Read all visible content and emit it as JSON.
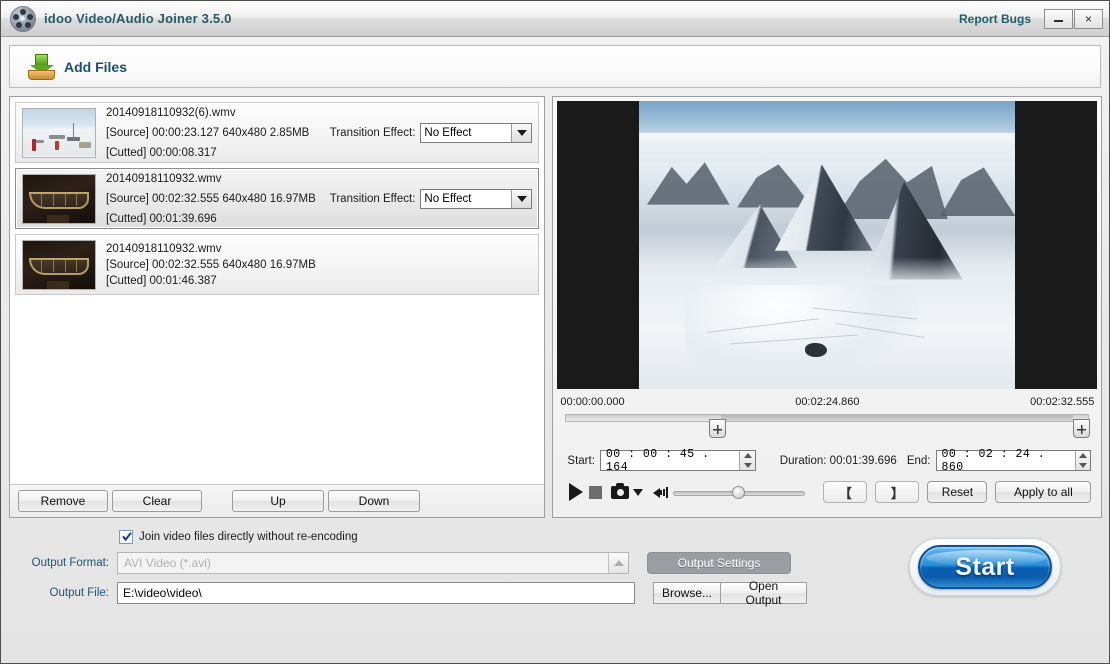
{
  "window": {
    "title": "idoo Video/Audio Joiner 3.5.0",
    "report_bugs": "Report Bugs",
    "minimize": "–",
    "close": "×",
    "logo_icon": "film-reel-icon"
  },
  "toolbar": {
    "add_files_label": "Add Files",
    "add_files_icon": "download-tray-icon"
  },
  "file_list": {
    "items": [
      {
        "name": "20140918110932(6).wmv",
        "source_label": "[Source]",
        "source_duration": "00:00:23.127",
        "resolution": "640x480",
        "size": "2.85MB",
        "cutted_label": "[Cutted]",
        "cutted_duration": "00:00:08.317",
        "transition_label": "Transition Effect:",
        "transition_value": "No Effect",
        "thumb": "snow-camp",
        "selected": false,
        "has_transition": true
      },
      {
        "name": "20140918110932.wmv",
        "source_label": "[Source]",
        "source_duration": "00:02:32.555",
        "resolution": "640x480",
        "size": "16.97MB",
        "cutted_label": "[Cutted]",
        "cutted_duration": "00:01:39.696",
        "transition_label": "Transition Effect:",
        "transition_value": "No Effect",
        "thumb": "dark-boat",
        "selected": true,
        "has_transition": true
      },
      {
        "name": "20140918110932.wmv",
        "source_label": "[Source]",
        "source_duration": "00:02:32.555",
        "resolution": "640x480",
        "size": "16.97MB",
        "cutted_label": "[Cutted]",
        "cutted_duration": "00:01:46.387",
        "transition_label": "",
        "transition_value": "",
        "thumb": "dark-boat",
        "selected": false,
        "has_transition": false
      }
    ],
    "buttons": {
      "remove": "Remove",
      "clear": "Clear",
      "up": "Up",
      "down": "Down"
    }
  },
  "preview": {
    "timeline": {
      "start_label": "00:00:00.000",
      "mid_label": "00:02:24.860",
      "end_label": "00:02:32.555",
      "left_handle_pct": 29.6,
      "right_handle_pct": 97.0
    },
    "trim": {
      "start_label": "Start:",
      "start_value": "00 : 00 : 45 . 164",
      "duration_label": "Duration:",
      "duration_value": "00:01:39.696",
      "end_label": "End:",
      "end_value": "00 : 02 : 24 . 860"
    },
    "controls": {
      "play_icon": "play-icon",
      "stop_icon": "stop-icon",
      "snapshot_icon": "camera-icon",
      "snapshot_menu_icon": "chevron-down-icon",
      "volume_icon": "speaker-icon",
      "volume_pct": 49,
      "mark_in": "【",
      "mark_out": "】",
      "reset": "Reset",
      "apply_to_all": "Apply to all"
    }
  },
  "output": {
    "join_checkbox_label": "Join video files directly without re-encoding",
    "join_checked": true,
    "format_label": "Output Format:",
    "format_value": "AVI Video (*.avi)",
    "format_disabled": true,
    "settings_button": "Output Settings",
    "settings_disabled": true,
    "file_label": "Output File:",
    "file_value": "E:\\video\\video\\",
    "browse_button": "Browse...",
    "open_output_button": "Open Output"
  },
  "start": {
    "label": "Start"
  },
  "colors": {
    "title_text": "#265a66",
    "accent_blue": "#1a4f75",
    "start_blue": "#0a62b5",
    "disabled_gray": "#9a9ea3"
  }
}
